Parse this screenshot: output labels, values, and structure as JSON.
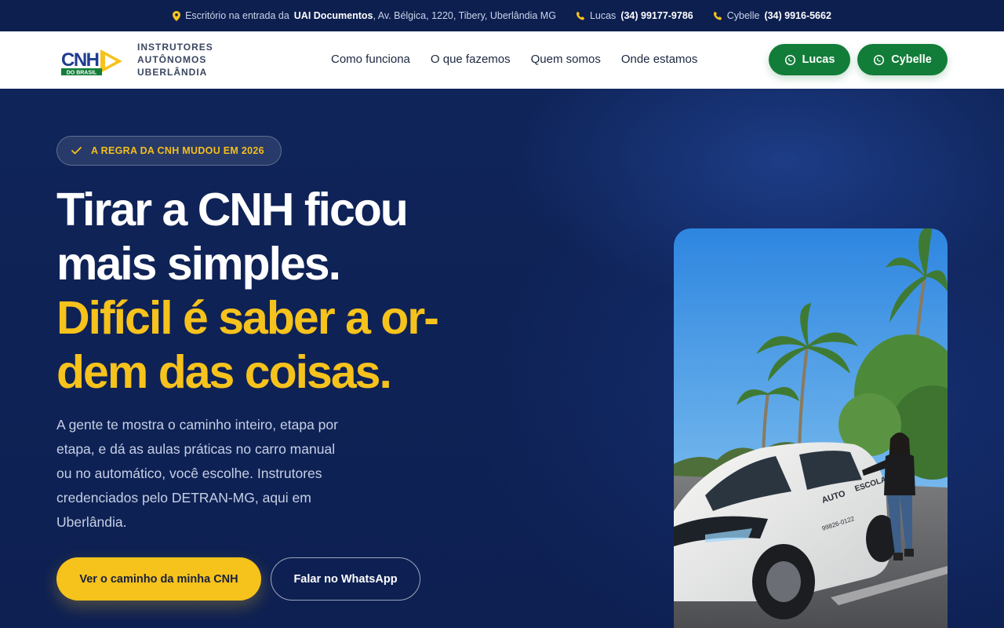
{
  "topbar": {
    "address_prefix": "Escritório na entrada da",
    "address_strong": "UAI Documentos",
    "address_rest": ", Av. Bélgica, 1220, Tibery, Uberlândia MG",
    "phone1_name": "Lucas",
    "phone1_number": "(34) 99177-9786",
    "phone2_name": "Cybelle",
    "phone2_number": "(34) 9916-5662"
  },
  "header": {
    "logo_text_line1": "INSTRUTORES",
    "logo_text_line2": "AUTÔNOMOS",
    "logo_text_line3": "UBERLÂNDIA",
    "logo_cnh": "CNH",
    "logo_sub": "DO BRASIL",
    "nav": [
      "Como funciona",
      "O que fazemos",
      "Quem somos",
      "Onde estamos"
    ],
    "btn_lucas": "Lucas",
    "btn_cybelle": "Cybelle"
  },
  "hero": {
    "badge": "A REGRA DA CNH MUDOU EM 2026",
    "headline_line1": "Tirar a CNH ficou",
    "headline_line2": "mais simples.",
    "headline_line3": "Difícil é saber a or-",
    "headline_line4": "dem das coisas.",
    "lede": "A gente te mostra o caminho inteiro, etapa por etapa, e dá as aulas práticas no carro manual ou no automático, você escolhe. Instrutores credenciados pelo DETRAN-MG, aqui em Uberlândia.",
    "cta_primary": "Ver o caminho da minha CNH",
    "cta_secondary": "Falar no WhatsApp",
    "car_text_auto": "AUTO",
    "car_text_escola": "ESCOLA",
    "car_phone": "99826-0122"
  },
  "colors": {
    "navy": "#0f2257",
    "yellow": "#f6c21c",
    "green": "#127d39"
  }
}
